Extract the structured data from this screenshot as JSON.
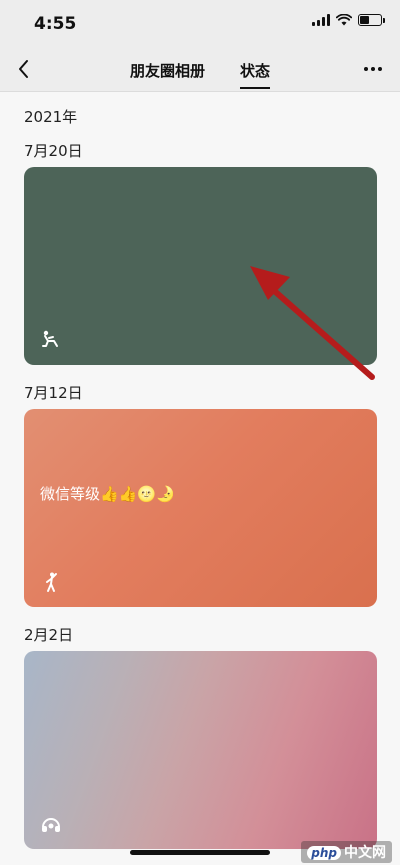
{
  "status_bar": {
    "time": "4:55"
  },
  "nav": {
    "tabs": [
      {
        "label": "朋友圈相册",
        "active": false
      },
      {
        "label": "状态",
        "active": true
      }
    ]
  },
  "timeline": {
    "year": "2021年",
    "entries": [
      {
        "date": "7月20日",
        "color": "#4d6458",
        "text": "",
        "icon": "status-pose-icon"
      },
      {
        "date": "7月12日",
        "color": "#e27d5e",
        "text": "微信等级👍👍🌝🌛",
        "icon": "status-dance-icon"
      },
      {
        "date": "2月2日",
        "color": "#c9a4a7",
        "text": "",
        "icon": "status-headphones-icon"
      }
    ]
  },
  "annotation": {
    "color": "#b51c1c",
    "icon": "red-arrow-icon"
  },
  "watermark": {
    "logo": "php",
    "text": "中文网"
  }
}
